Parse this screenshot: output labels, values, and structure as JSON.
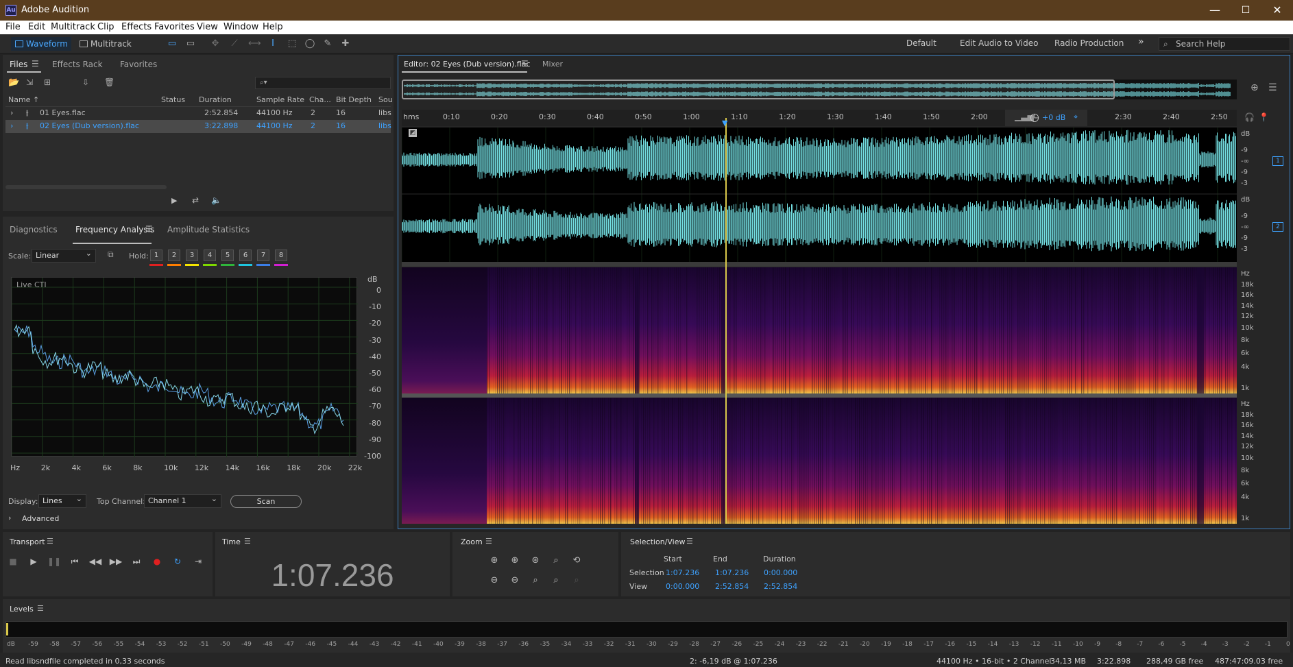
{
  "titlebar": {
    "app_title": "Adobe Audition",
    "app_icon": "Au",
    "minimize": "—",
    "maximize": "☐",
    "close": "✕"
  },
  "menu": [
    "File",
    "Edit",
    "Multitrack",
    "Clip",
    "Effects",
    "Favorites",
    "View",
    "Window",
    "Help"
  ],
  "toolbar": {
    "waveform": "Waveform",
    "multitrack": "Multitrack",
    "workspaces": [
      "Default",
      "Edit Audio to Video",
      "Radio Production"
    ],
    "more": "»",
    "search": "Search Help"
  },
  "files": {
    "tabs": [
      "Files",
      "Effects Rack",
      "Favorites"
    ],
    "search_icon": "⌕▾",
    "columns": [
      "Name ↑",
      "Status",
      "Duration",
      "Sample Rate",
      "Cha...",
      "Bit Depth",
      "Sou"
    ],
    "rows": [
      {
        "name": "01 Eyes.flac",
        "status": "",
        "duration": "2:52.854",
        "rate": "44100 Hz",
        "channels": "2",
        "depth": "16",
        "source": "libs"
      },
      {
        "name": "02 Eyes (Dub version).flac",
        "status": "",
        "duration": "3:22.898",
        "rate": "44100 Hz",
        "channels": "2",
        "depth": "16",
        "source": "libs"
      }
    ]
  },
  "analysis": {
    "tabs": [
      "Diagnostics",
      "Frequency Analysis",
      "Amplitude Statistics"
    ],
    "scale_label": "Scale:",
    "scale_value": "Linear",
    "hold_label": "Hold:",
    "holds": [
      "1",
      "2",
      "3",
      "4",
      "5",
      "6",
      "7",
      "8"
    ],
    "hold_colors": [
      "#e02020",
      "#ff7d00",
      "#f4e400",
      "#7fd900",
      "#2fb53b",
      "#1fc6e0",
      "#3b7ee8",
      "#d21fd2"
    ],
    "live_cti": "Live CTI",
    "db_unit": "dB",
    "db_ticks": [
      "0",
      "-10",
      "-20",
      "-30",
      "-40",
      "-50",
      "-60",
      "-70",
      "-80",
      "-90",
      "-100"
    ],
    "hz_ticks": [
      "Hz",
      "2k",
      "4k",
      "6k",
      "8k",
      "10k",
      "12k",
      "14k",
      "16k",
      "18k",
      "20k",
      "22k"
    ],
    "display_label": "Display:",
    "display_value": "Lines",
    "top_channel_label": "Top Channel:",
    "top_channel_value": "Channel 1",
    "scan": "Scan",
    "advanced": "Advanced"
  },
  "editor": {
    "tab": "Editor: 02 Eyes (Dub version).flac",
    "mixer": "Mixer",
    "ruler": [
      "hms",
      "0:10",
      "0:20",
      "0:30",
      "0:40",
      "0:50",
      "1:00",
      "1:10",
      "1:20",
      "1:30",
      "1:40",
      "1:50",
      "2:00",
      "2:30",
      "2:40",
      "2:50"
    ],
    "volume": "+0 dB",
    "db_ticks": [
      "dB",
      "-9",
      "-∞",
      "-9",
      "-3"
    ],
    "channels": [
      "1",
      "2"
    ],
    "hz_ticks": [
      "Hz",
      "18k",
      "16k",
      "14k",
      "12k",
      "10k",
      "8k",
      "6k",
      "4k",
      "1k"
    ],
    "playhead_fraction": 0.39
  },
  "transport": {
    "title": "Transport",
    "icons": [
      "■",
      "▶",
      "❚❚",
      "⏮",
      "◀◀",
      "▶▶",
      "⏭",
      "●",
      "↻",
      "⇥"
    ]
  },
  "time": {
    "title": "Time",
    "value": "1:07.236"
  },
  "zoom": {
    "title": "Zoom"
  },
  "selection": {
    "title": "Selection/View",
    "start": "Start",
    "end": "End",
    "duration": "Duration",
    "sel_label": "Selection",
    "view_label": "View",
    "sel": [
      "1:07.236",
      "1:07.236",
      "0:00.000"
    ],
    "view": [
      "0:00.000",
      "2:52.854",
      "2:52.854"
    ]
  },
  "levels": {
    "title": "Levels",
    "ticks": [
      "dB",
      "-59",
      "-58",
      "-57",
      "-56",
      "-55",
      "-54",
      "-53",
      "-52",
      "-51",
      "-50",
      "-49",
      "-48",
      "-47",
      "-46",
      "-45",
      "-44",
      "-43",
      "-42",
      "-41",
      "-40",
      "-39",
      "-38",
      "-37",
      "-36",
      "-35",
      "-34",
      "-33",
      "-32",
      "-31",
      "-30",
      "-29",
      "-28",
      "-27",
      "-26",
      "-25",
      "-24",
      "-23",
      "-22",
      "-21",
      "-20",
      "-19",
      "-18",
      "-17",
      "-16",
      "-15",
      "-14",
      "-13",
      "-12",
      "-11",
      "-10",
      "-9",
      "-8",
      "-7",
      "-6",
      "-5",
      "-4",
      "-3",
      "-2",
      "-1",
      "0"
    ]
  },
  "status": {
    "left": "Read libsndfile completed in 0,33 seconds",
    "cursor": "2: -6,19 dB @ 1:07.236",
    "format": "44100 Hz • 16-bit • 2 Channel",
    "size": "34,13 MB",
    "duration": "3:22.898",
    "free": "288,49 GB free",
    "free_time": "487:47:09.03 free"
  }
}
